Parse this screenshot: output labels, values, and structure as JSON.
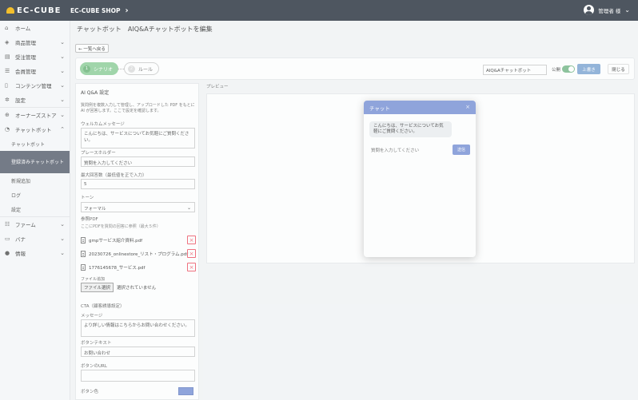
{
  "header": {
    "logo_text": "EC-CUBE",
    "shop_name": "EC-CUBE SHOP",
    "user_name": "管理者 様"
  },
  "sidebar": {
    "items": [
      {
        "label": "ホーム",
        "icon": "home-icon"
      },
      {
        "label": "商品管理",
        "icon": "tag-icon"
      },
      {
        "label": "受注管理",
        "icon": "cart-icon"
      },
      {
        "label": "会員管理",
        "icon": "users-icon"
      },
      {
        "label": "コンテンツ管理",
        "icon": "file-icon"
      },
      {
        "label": "設定",
        "icon": "gear-icon"
      },
      {
        "label": "オーナーズストア",
        "icon": "store-icon"
      },
      {
        "label": "チャットボット",
        "icon": "chat-icon"
      }
    ],
    "sub_items": [
      {
        "label": "チャットボット"
      },
      {
        "label": "登録済みチャットボット"
      },
      {
        "label": "新規追加"
      },
      {
        "label": "ログ"
      },
      {
        "label": "設定"
      }
    ],
    "bottom_items": [
      {
        "label": "ファーム",
        "icon": "form-icon"
      },
      {
        "label": "バナ",
        "icon": "banner-icon"
      },
      {
        "label": "情報",
        "icon": "info-icon"
      }
    ]
  },
  "page": {
    "title": "チャットボット　AIQ&Aチャットボットを編集",
    "back_label": "← 一覧へ戻る"
  },
  "toolbar": {
    "step1_num": "1",
    "step1_label": "シナリオ",
    "step2_num": "2",
    "step2_label": "ルール",
    "name_value": "AIQ&Aチャットボット",
    "public_label": "公開",
    "save_label": "上書き",
    "close_label": "閉じる"
  },
  "settings": {
    "title": "AI Q&A 設定",
    "help_text": "質問例を複数入力して管理し、アップロードした PDF をもとに AI が回答します。ここで設定を確認します。",
    "welcome_label": "ウェルカムメッセージ",
    "welcome_value": "こんにちは、サービスについてお気軽にご質問ください。",
    "placeholder_label": "プレースホルダー",
    "placeholder_value": "質問を入力してください",
    "max_label": "最大回答数（最低値を正で入力）",
    "max_value": "5",
    "tone_label": "トーン",
    "tone_value": "フォーマル",
    "pdf_label": "参照PDF",
    "pdf_note": "ここにPDFを質問の回答に参照（最大５件）",
    "files": [
      {
        "name": "gmpサービス紹介資料.pdf"
      },
      {
        "name": "20230726_onlinestore_リスト・プログラム.pdf"
      },
      {
        "name": "1776145678_サービス.pdf"
      }
    ],
    "file_add_label": "ファイル追加",
    "choose_label": "ファイル選択",
    "no_file_label": "選択されていません",
    "cta_label": "CTA（顧客誘導設定）",
    "message_label": "メッセージ",
    "message_value": "より詳しい情報はこちらからお問い合わせください。",
    "button_text_label": "ボタンテキスト",
    "button_text_value": "お問い合わせ",
    "button_url_label": "ボタンのURL",
    "button_url_value": "",
    "button_color_label": "ボタン色",
    "button_color": "#7b93d6"
  },
  "preview": {
    "label": "プレビュー",
    "widget_title": "チャット",
    "close_glyph": "×",
    "bubble_text": "こんにちは、サービスについてお気軽にご質問ください。",
    "input_placeholder": "質問を入力してください",
    "send_label": "送信"
  },
  "colors": {
    "header_bg": "#2b3440",
    "accent": "#7b93d6",
    "step_active": "#8fcf9a",
    "save": "#7fa7d4",
    "danger": "#e56"
  }
}
